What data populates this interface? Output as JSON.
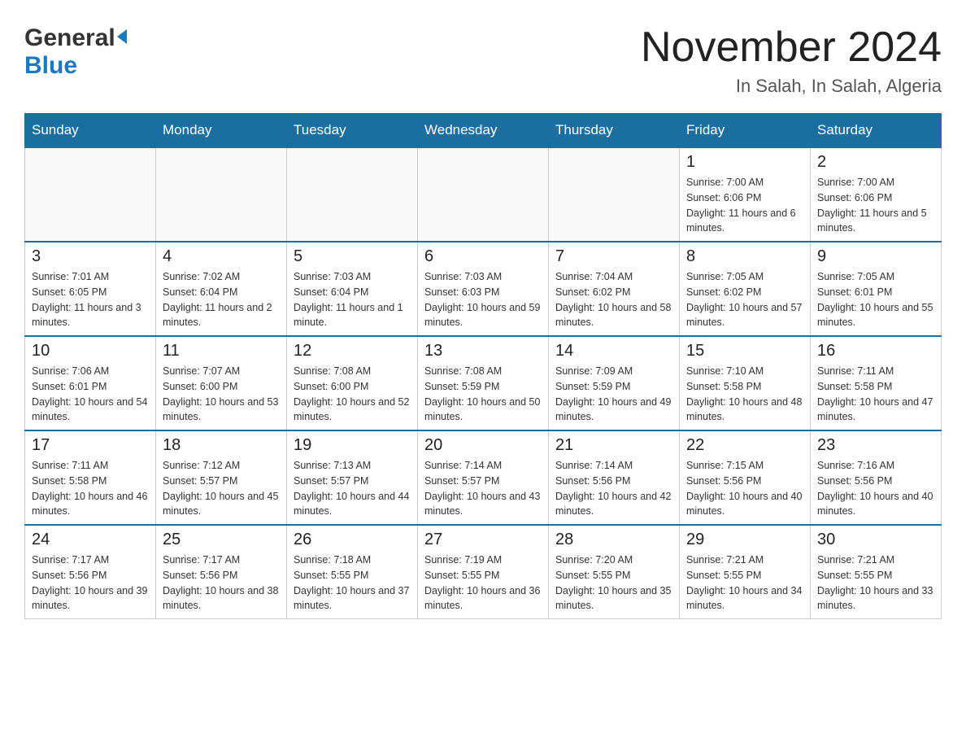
{
  "header": {
    "logo_general": "General",
    "logo_blue": "Blue",
    "month_year": "November 2024",
    "location": "In Salah, In Salah, Algeria"
  },
  "days_of_week": [
    "Sunday",
    "Monday",
    "Tuesday",
    "Wednesday",
    "Thursday",
    "Friday",
    "Saturday"
  ],
  "weeks": [
    [
      {
        "day": "",
        "info": ""
      },
      {
        "day": "",
        "info": ""
      },
      {
        "day": "",
        "info": ""
      },
      {
        "day": "",
        "info": ""
      },
      {
        "day": "",
        "info": ""
      },
      {
        "day": "1",
        "info": "Sunrise: 7:00 AM\nSunset: 6:06 PM\nDaylight: 11 hours and 6 minutes."
      },
      {
        "day": "2",
        "info": "Sunrise: 7:00 AM\nSunset: 6:06 PM\nDaylight: 11 hours and 5 minutes."
      }
    ],
    [
      {
        "day": "3",
        "info": "Sunrise: 7:01 AM\nSunset: 6:05 PM\nDaylight: 11 hours and 3 minutes."
      },
      {
        "day": "4",
        "info": "Sunrise: 7:02 AM\nSunset: 6:04 PM\nDaylight: 11 hours and 2 minutes."
      },
      {
        "day": "5",
        "info": "Sunrise: 7:03 AM\nSunset: 6:04 PM\nDaylight: 11 hours and 1 minute."
      },
      {
        "day": "6",
        "info": "Sunrise: 7:03 AM\nSunset: 6:03 PM\nDaylight: 10 hours and 59 minutes."
      },
      {
        "day": "7",
        "info": "Sunrise: 7:04 AM\nSunset: 6:02 PM\nDaylight: 10 hours and 58 minutes."
      },
      {
        "day": "8",
        "info": "Sunrise: 7:05 AM\nSunset: 6:02 PM\nDaylight: 10 hours and 57 minutes."
      },
      {
        "day": "9",
        "info": "Sunrise: 7:05 AM\nSunset: 6:01 PM\nDaylight: 10 hours and 55 minutes."
      }
    ],
    [
      {
        "day": "10",
        "info": "Sunrise: 7:06 AM\nSunset: 6:01 PM\nDaylight: 10 hours and 54 minutes."
      },
      {
        "day": "11",
        "info": "Sunrise: 7:07 AM\nSunset: 6:00 PM\nDaylight: 10 hours and 53 minutes."
      },
      {
        "day": "12",
        "info": "Sunrise: 7:08 AM\nSunset: 6:00 PM\nDaylight: 10 hours and 52 minutes."
      },
      {
        "day": "13",
        "info": "Sunrise: 7:08 AM\nSunset: 5:59 PM\nDaylight: 10 hours and 50 minutes."
      },
      {
        "day": "14",
        "info": "Sunrise: 7:09 AM\nSunset: 5:59 PM\nDaylight: 10 hours and 49 minutes."
      },
      {
        "day": "15",
        "info": "Sunrise: 7:10 AM\nSunset: 5:58 PM\nDaylight: 10 hours and 48 minutes."
      },
      {
        "day": "16",
        "info": "Sunrise: 7:11 AM\nSunset: 5:58 PM\nDaylight: 10 hours and 47 minutes."
      }
    ],
    [
      {
        "day": "17",
        "info": "Sunrise: 7:11 AM\nSunset: 5:58 PM\nDaylight: 10 hours and 46 minutes."
      },
      {
        "day": "18",
        "info": "Sunrise: 7:12 AM\nSunset: 5:57 PM\nDaylight: 10 hours and 45 minutes."
      },
      {
        "day": "19",
        "info": "Sunrise: 7:13 AM\nSunset: 5:57 PM\nDaylight: 10 hours and 44 minutes."
      },
      {
        "day": "20",
        "info": "Sunrise: 7:14 AM\nSunset: 5:57 PM\nDaylight: 10 hours and 43 minutes."
      },
      {
        "day": "21",
        "info": "Sunrise: 7:14 AM\nSunset: 5:56 PM\nDaylight: 10 hours and 42 minutes."
      },
      {
        "day": "22",
        "info": "Sunrise: 7:15 AM\nSunset: 5:56 PM\nDaylight: 10 hours and 40 minutes."
      },
      {
        "day": "23",
        "info": "Sunrise: 7:16 AM\nSunset: 5:56 PM\nDaylight: 10 hours and 40 minutes."
      }
    ],
    [
      {
        "day": "24",
        "info": "Sunrise: 7:17 AM\nSunset: 5:56 PM\nDaylight: 10 hours and 39 minutes."
      },
      {
        "day": "25",
        "info": "Sunrise: 7:17 AM\nSunset: 5:56 PM\nDaylight: 10 hours and 38 minutes."
      },
      {
        "day": "26",
        "info": "Sunrise: 7:18 AM\nSunset: 5:55 PM\nDaylight: 10 hours and 37 minutes."
      },
      {
        "day": "27",
        "info": "Sunrise: 7:19 AM\nSunset: 5:55 PM\nDaylight: 10 hours and 36 minutes."
      },
      {
        "day": "28",
        "info": "Sunrise: 7:20 AM\nSunset: 5:55 PM\nDaylight: 10 hours and 35 minutes."
      },
      {
        "day": "29",
        "info": "Sunrise: 7:21 AM\nSunset: 5:55 PM\nDaylight: 10 hours and 34 minutes."
      },
      {
        "day": "30",
        "info": "Sunrise: 7:21 AM\nSunset: 5:55 PM\nDaylight: 10 hours and 33 minutes."
      }
    ]
  ]
}
